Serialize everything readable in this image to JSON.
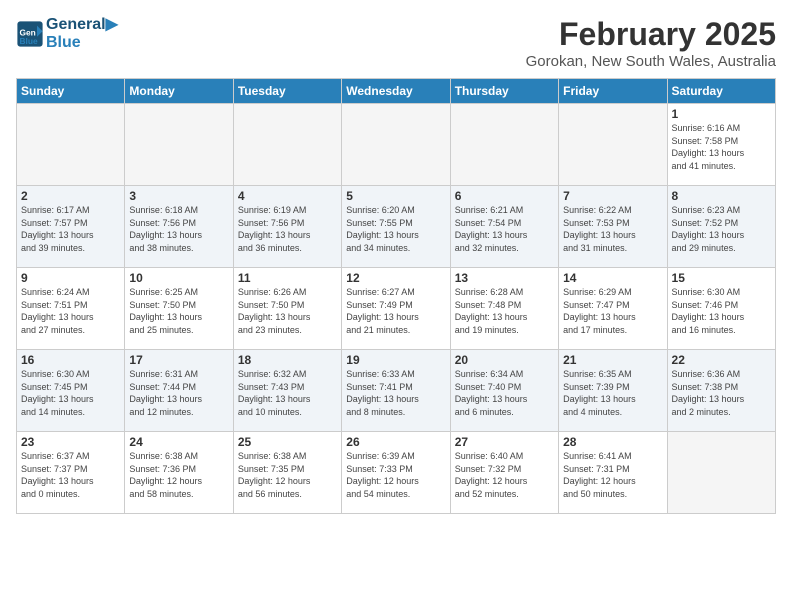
{
  "logo": {
    "line1": "General",
    "line2": "Blue"
  },
  "title": "February 2025",
  "location": "Gorokan, New South Wales, Australia",
  "days_of_week": [
    "Sunday",
    "Monday",
    "Tuesday",
    "Wednesday",
    "Thursday",
    "Friday",
    "Saturday"
  ],
  "weeks": [
    {
      "shade": false,
      "days": [
        {
          "num": "",
          "info": ""
        },
        {
          "num": "",
          "info": ""
        },
        {
          "num": "",
          "info": ""
        },
        {
          "num": "",
          "info": ""
        },
        {
          "num": "",
          "info": ""
        },
        {
          "num": "",
          "info": ""
        },
        {
          "num": "1",
          "info": "Sunrise: 6:16 AM\nSunset: 7:58 PM\nDaylight: 13 hours\nand 41 minutes."
        }
      ]
    },
    {
      "shade": true,
      "days": [
        {
          "num": "2",
          "info": "Sunrise: 6:17 AM\nSunset: 7:57 PM\nDaylight: 13 hours\nand 39 minutes."
        },
        {
          "num": "3",
          "info": "Sunrise: 6:18 AM\nSunset: 7:56 PM\nDaylight: 13 hours\nand 38 minutes."
        },
        {
          "num": "4",
          "info": "Sunrise: 6:19 AM\nSunset: 7:56 PM\nDaylight: 13 hours\nand 36 minutes."
        },
        {
          "num": "5",
          "info": "Sunrise: 6:20 AM\nSunset: 7:55 PM\nDaylight: 13 hours\nand 34 minutes."
        },
        {
          "num": "6",
          "info": "Sunrise: 6:21 AM\nSunset: 7:54 PM\nDaylight: 13 hours\nand 32 minutes."
        },
        {
          "num": "7",
          "info": "Sunrise: 6:22 AM\nSunset: 7:53 PM\nDaylight: 13 hours\nand 31 minutes."
        },
        {
          "num": "8",
          "info": "Sunrise: 6:23 AM\nSunset: 7:52 PM\nDaylight: 13 hours\nand 29 minutes."
        }
      ]
    },
    {
      "shade": false,
      "days": [
        {
          "num": "9",
          "info": "Sunrise: 6:24 AM\nSunset: 7:51 PM\nDaylight: 13 hours\nand 27 minutes."
        },
        {
          "num": "10",
          "info": "Sunrise: 6:25 AM\nSunset: 7:50 PM\nDaylight: 13 hours\nand 25 minutes."
        },
        {
          "num": "11",
          "info": "Sunrise: 6:26 AM\nSunset: 7:50 PM\nDaylight: 13 hours\nand 23 minutes."
        },
        {
          "num": "12",
          "info": "Sunrise: 6:27 AM\nSunset: 7:49 PM\nDaylight: 13 hours\nand 21 minutes."
        },
        {
          "num": "13",
          "info": "Sunrise: 6:28 AM\nSunset: 7:48 PM\nDaylight: 13 hours\nand 19 minutes."
        },
        {
          "num": "14",
          "info": "Sunrise: 6:29 AM\nSunset: 7:47 PM\nDaylight: 13 hours\nand 17 minutes."
        },
        {
          "num": "15",
          "info": "Sunrise: 6:30 AM\nSunset: 7:46 PM\nDaylight: 13 hours\nand 16 minutes."
        }
      ]
    },
    {
      "shade": true,
      "days": [
        {
          "num": "16",
          "info": "Sunrise: 6:30 AM\nSunset: 7:45 PM\nDaylight: 13 hours\nand 14 minutes."
        },
        {
          "num": "17",
          "info": "Sunrise: 6:31 AM\nSunset: 7:44 PM\nDaylight: 13 hours\nand 12 minutes."
        },
        {
          "num": "18",
          "info": "Sunrise: 6:32 AM\nSunset: 7:43 PM\nDaylight: 13 hours\nand 10 minutes."
        },
        {
          "num": "19",
          "info": "Sunrise: 6:33 AM\nSunset: 7:41 PM\nDaylight: 13 hours\nand 8 minutes."
        },
        {
          "num": "20",
          "info": "Sunrise: 6:34 AM\nSunset: 7:40 PM\nDaylight: 13 hours\nand 6 minutes."
        },
        {
          "num": "21",
          "info": "Sunrise: 6:35 AM\nSunset: 7:39 PM\nDaylight: 13 hours\nand 4 minutes."
        },
        {
          "num": "22",
          "info": "Sunrise: 6:36 AM\nSunset: 7:38 PM\nDaylight: 13 hours\nand 2 minutes."
        }
      ]
    },
    {
      "shade": false,
      "days": [
        {
          "num": "23",
          "info": "Sunrise: 6:37 AM\nSunset: 7:37 PM\nDaylight: 13 hours\nand 0 minutes."
        },
        {
          "num": "24",
          "info": "Sunrise: 6:38 AM\nSunset: 7:36 PM\nDaylight: 12 hours\nand 58 minutes."
        },
        {
          "num": "25",
          "info": "Sunrise: 6:38 AM\nSunset: 7:35 PM\nDaylight: 12 hours\nand 56 minutes."
        },
        {
          "num": "26",
          "info": "Sunrise: 6:39 AM\nSunset: 7:33 PM\nDaylight: 12 hours\nand 54 minutes."
        },
        {
          "num": "27",
          "info": "Sunrise: 6:40 AM\nSunset: 7:32 PM\nDaylight: 12 hours\nand 52 minutes."
        },
        {
          "num": "28",
          "info": "Sunrise: 6:41 AM\nSunset: 7:31 PM\nDaylight: 12 hours\nand 50 minutes."
        },
        {
          "num": "",
          "info": ""
        }
      ]
    }
  ]
}
